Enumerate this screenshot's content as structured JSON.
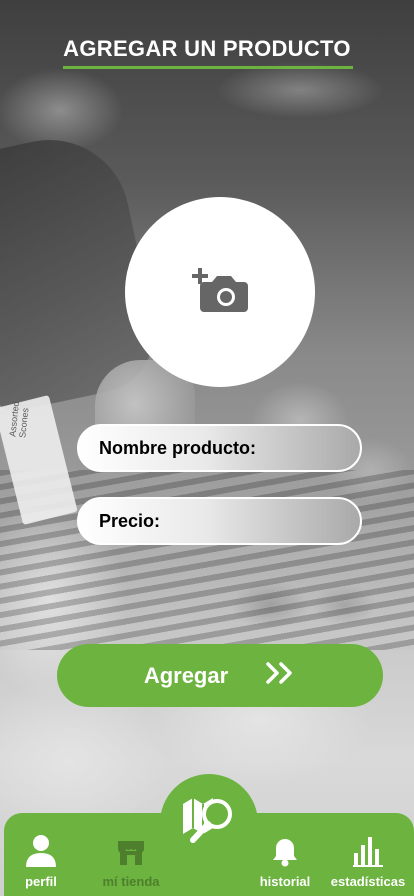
{
  "header": {
    "title": "AGREGAR UN PRODUCTO"
  },
  "photo": {
    "icon": "add-photo-camera-icon"
  },
  "form": {
    "name_label": "Nombre producto:",
    "price_label": "Precio:"
  },
  "action": {
    "add_label": "Agregar",
    "arrow_icon": "double-chevron-right-icon"
  },
  "background": {
    "sign_text": "Assorted Scones"
  },
  "nav": {
    "items": [
      {
        "label": "perfil",
        "icon": "person-icon"
      },
      {
        "label": "mí tienda",
        "icon": "store-icon"
      },
      {
        "label": "historial",
        "icon": "bell-icon"
      },
      {
        "label": "estadísticas",
        "icon": "bar-chart-icon"
      }
    ],
    "center_icon": "map-search-icon"
  },
  "colors": {
    "accent": "#6db33f",
    "accent_dark": "#4e7f2d",
    "white": "#ffffff"
  }
}
